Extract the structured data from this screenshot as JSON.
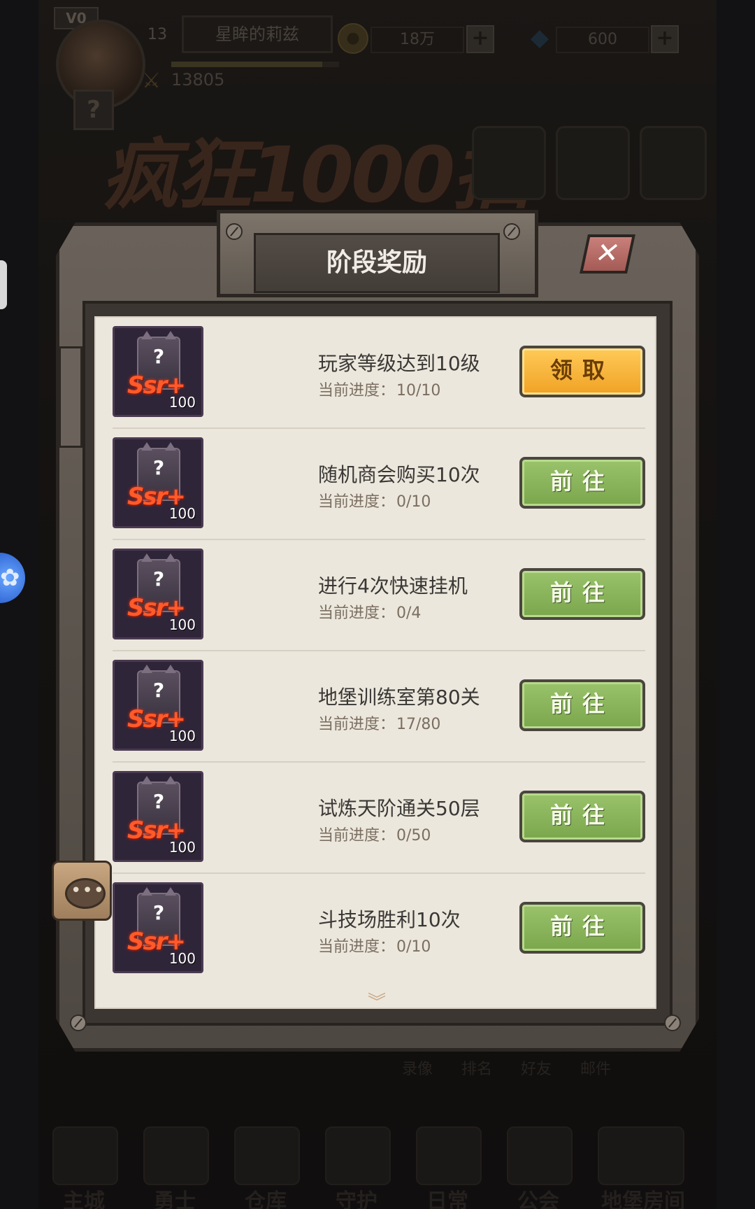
{
  "top": {
    "vip": "V0",
    "level": "13",
    "player_name": "星眸的莉兹",
    "power": "13805",
    "gold": "18万",
    "gems": "600"
  },
  "banner": {
    "title": "疯狂1000抽"
  },
  "behind": {
    "links": [
      "录像",
      "排名",
      "好友",
      "邮件"
    ],
    "nav": [
      "主城",
      "勇士",
      "仓库",
      "守护",
      "日常",
      "公会",
      "地堡房间"
    ]
  },
  "modal": {
    "title": "阶段奖励",
    "close_icon": "close-icon",
    "reward_item": {
      "label": "Ssr+",
      "count": "100",
      "icon": "mystery-ssr-card-icon"
    },
    "progress_label": "当前进度：",
    "tasks": [
      {
        "name": "玩家等级达到10级",
        "progress": "10/10",
        "button": "领取",
        "state": "claim"
      },
      {
        "name": "随机商会购买10次",
        "progress": "0/10",
        "button": "前往",
        "state": "go"
      },
      {
        "name": "进行4次快速挂机",
        "progress": "0/4",
        "button": "前往",
        "state": "go"
      },
      {
        "name": "地堡训练室第80关",
        "progress": "17/80",
        "button": "前往",
        "state": "go"
      },
      {
        "name": "试炼天阶通关50层",
        "progress": "0/50",
        "button": "前往",
        "state": "go"
      },
      {
        "name": "斗技场胜利10次",
        "progress": "0/10",
        "button": "前往",
        "state": "go"
      }
    ]
  },
  "colors": {
    "claim_button": "#f0a225",
    "go_button": "#7aa64c",
    "paper": "#ece7dc",
    "ssr_text": "#ff5a2a"
  }
}
